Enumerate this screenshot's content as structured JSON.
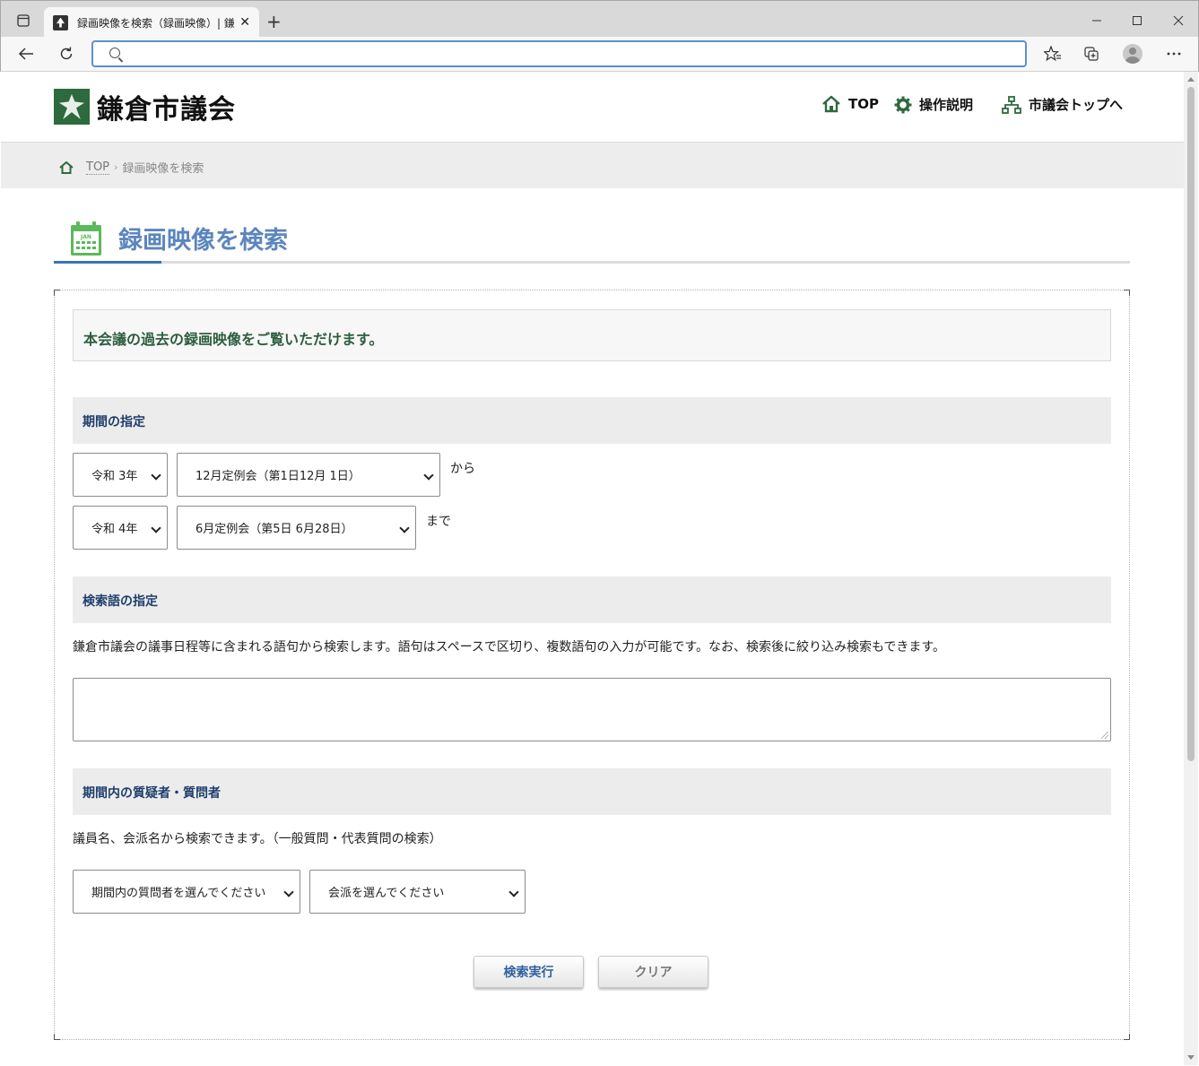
{
  "browser": {
    "tab_title": "録画映像を検索（録画映像）| 鎌倉市議会",
    "address": ""
  },
  "site": {
    "logo_text": "鎌倉市議会",
    "nav": [
      {
        "label": "TOP",
        "icon": "home-icon"
      },
      {
        "label": "操作説明",
        "icon": "gear-icon"
      },
      {
        "label": "市議会トップへ",
        "icon": "sitemap-icon"
      }
    ]
  },
  "breadcrumb": {
    "home": "TOP",
    "separator": "›",
    "current": "録画映像を検索"
  },
  "page": {
    "title": "録画映像を検索",
    "calendar_label": "JAN"
  },
  "form": {
    "intro": "本会議の過去の録画映像をご覧いただけます。",
    "period": {
      "heading": "期間の指定",
      "from_year": "令和 3年",
      "from_session": "12月定例会（第1日12月 1日）",
      "from_suffix": "から",
      "to_year": "令和 4年",
      "to_session": "6月定例会（第5日 6月28日）",
      "to_suffix": "まで"
    },
    "keyword": {
      "heading": "検索語の指定",
      "description": "鎌倉市議会の議事日程等に含まれる語句から検索します。語句はスペースで区切り、複数語句の入力が可能です。なお、検索後に絞り込み検索もできます。",
      "value": ""
    },
    "speaker": {
      "heading": "期間内の質疑者・質問者",
      "description": "議員名、会派名から検索できます。（一般質問・代表質問の検索）",
      "member_select": "期間内の質問者を選んでください",
      "faction_select": "会派を選んでください"
    },
    "buttons": {
      "search": "検索実行",
      "clear": "クリア"
    }
  },
  "colors": {
    "accent_blue": "#3b72b8",
    "brand_green": "#2d6a3e",
    "heading_navy": "#1f3e6b"
  }
}
